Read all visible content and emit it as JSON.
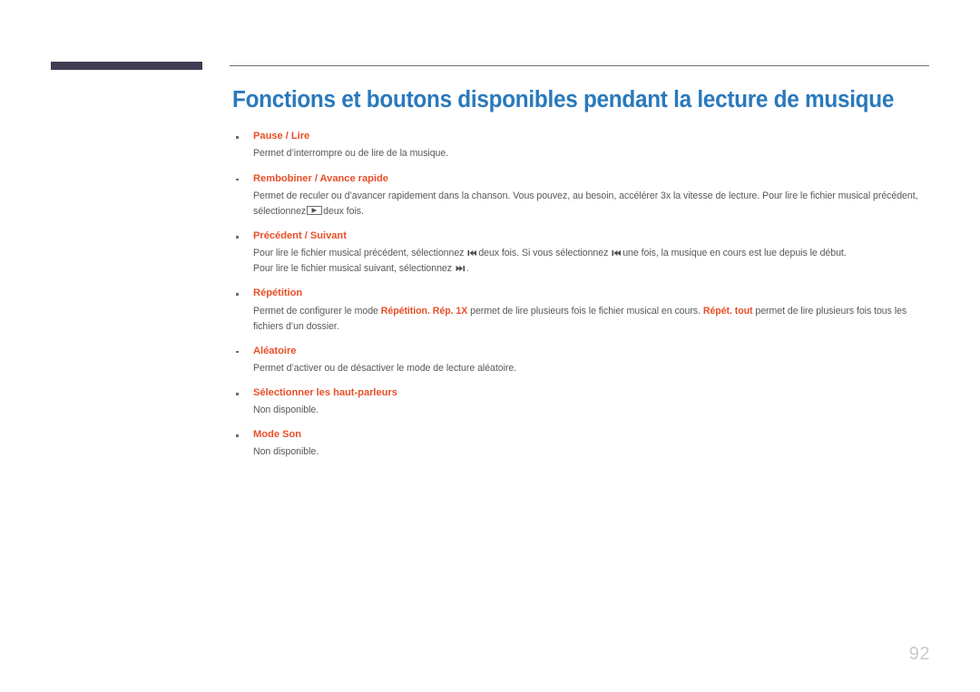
{
  "page": {
    "title": "Fonctions et boutons disponibles pendant la lecture de musique",
    "number": "92"
  },
  "colors": {
    "heading": "#2a79bd",
    "label": "#e8502a",
    "body": "#58595b",
    "deco_bar": "#413b52",
    "deco_rule": "#6d6e71",
    "page_number": "#c9cacc"
  },
  "items": [
    {
      "label": "Pause / Lire",
      "lines": [
        "Permet d’interrompre ou de lire de la musique."
      ]
    },
    {
      "label": "Rembobiner / Avance rapide",
      "lines": [
        "Permet de reculer ou d’avancer rapidement dans la chanson. Vous pouvez, au besoin, accélérer 3x la vitesse de lecture. Pour lire le fichier musical précédent, sélectionnez ▶ deux fois."
      ]
    },
    {
      "label": "Précédent / Suivant",
      "lines": [
        "Pour lire le fichier musical précédent, sélectionnez ⏮ deux fois. Si vous sélectionnez ⏮ une fois, la musique en cours est lue depuis le début.",
        "Pour lire le fichier musical suivant, sélectionnez ⏭."
      ]
    },
    {
      "label": "Répétition",
      "lines": [
        "Permet de configurer le mode Répétition. Rép. 1X permet de lire plusieurs fois le fichier musical en cours. Répét. tout permet de lire plusieurs fois tous les fichiers d’un dossier."
      ]
    },
    {
      "label": "Aléatoire",
      "lines": [
        "Permet d’activer ou de désactiver le mode de lecture aléatoire."
      ]
    },
    {
      "label": "Sélectionner les haut-parleurs",
      "lines": [
        "Non disponible."
      ]
    },
    {
      "label": "Mode Son",
      "lines": [
        "Non disponible."
      ]
    }
  ],
  "item_text": {
    "pause_lire": {
      "label": "Pause / Lire",
      "desc": "Permet d’interrompre ou de lire de la musique."
    },
    "rembobiner": {
      "label": "Rembobiner / Avance rapide",
      "desc_before_icon": "Permet de reculer ou d’avancer rapidement dans la chanson. Vous pouvez, au besoin, accélérer 3x la vitesse de lecture. Pour lire le fichier musical précédent, sélectionnez",
      "desc_after_icon": "deux fois."
    },
    "precedent": {
      "label": "Précédent / Suivant",
      "line1_a": "Pour lire le fichier musical précédent, sélectionnez",
      "line1_b": "deux fois. Si vous sélectionnez",
      "line1_c": "une fois, la musique en cours est lue depuis le début.",
      "line2_a": "Pour lire le fichier musical suivant, sélectionnez",
      "line2_b": "."
    },
    "repetition": {
      "label": "Répétition",
      "desc_a": "Permet de configurer le mode",
      "bold_1": "Répétition",
      "desc_b": ".",
      "bold_2": "Rép. 1X",
      "desc_c": "permet de lire plusieurs fois le fichier musical en cours.",
      "bold_3": "Répét. tout",
      "desc_d": "permet de lire plusieurs fois tous les fichiers d’un dossier."
    },
    "aleatoire": {
      "label": "Aléatoire",
      "desc": "Permet d’activer ou de désactiver le mode de lecture aléatoire."
    },
    "haut_parleurs": {
      "label": "Sélectionner les haut-parleurs",
      "desc": "Non disponible."
    },
    "mode_son": {
      "label": "Mode Son",
      "desc": "Non disponible."
    }
  },
  "icons": {
    "play": "play-icon",
    "previous": "previous-track-icon",
    "next": "next-track-icon"
  }
}
